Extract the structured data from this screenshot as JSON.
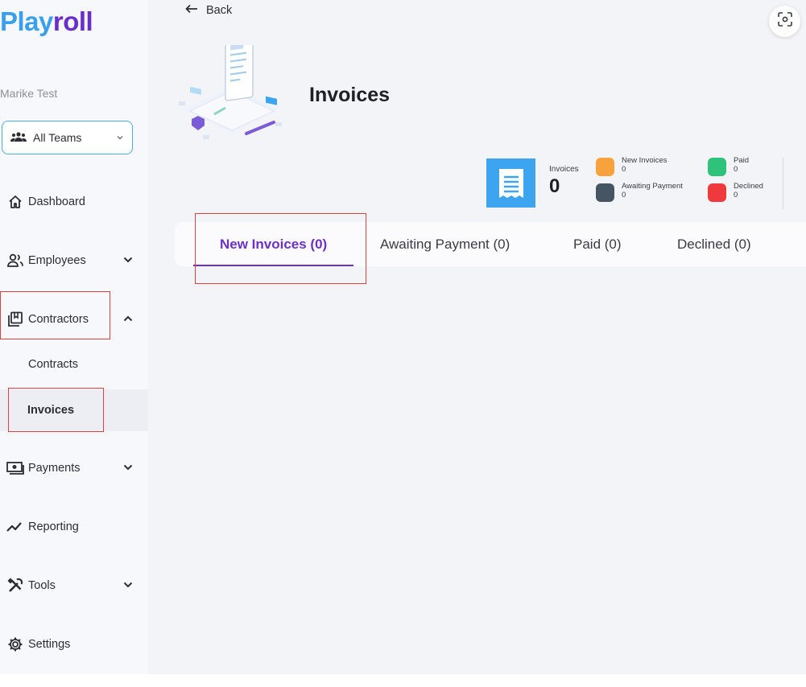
{
  "app": {
    "logo_part1": "Play",
    "logo_part2": "roll",
    "user_name": "Marike Test"
  },
  "team_select": {
    "value": "All Teams"
  },
  "nav": {
    "dashboard": "Dashboard",
    "employees": "Employees",
    "contractors": "Contractors",
    "contracts": "Contracts",
    "invoices": "Invoices",
    "payments": "Payments",
    "reporting": "Reporting",
    "tools": "Tools",
    "settings": "Settings"
  },
  "header": {
    "back_label": "Back",
    "title": "Invoices"
  },
  "stats": {
    "label": "Invoices",
    "total": "0",
    "legend": [
      {
        "label": "New Invoices",
        "count": "0",
        "color": "#f7a23c"
      },
      {
        "label": "Paid",
        "count": "0",
        "color": "#2fc27a"
      },
      {
        "label": "Awaiting Payment",
        "count": "0",
        "color": "#455662"
      },
      {
        "label": "Declined",
        "count": "0",
        "color": "#f0393c"
      }
    ]
  },
  "tabs": [
    {
      "label": "New Invoices (0)",
      "active": true
    },
    {
      "label": "Awaiting Payment (0)",
      "active": false
    },
    {
      "label": "Paid (0)",
      "active": false
    },
    {
      "label": "Declined (0)",
      "active": false
    }
  ],
  "colors": {
    "brand_blue": "#3aa0ee",
    "brand_purple": "#6b2fc9",
    "active_tab": "#6c31c6",
    "highlight": "#e0403f"
  }
}
